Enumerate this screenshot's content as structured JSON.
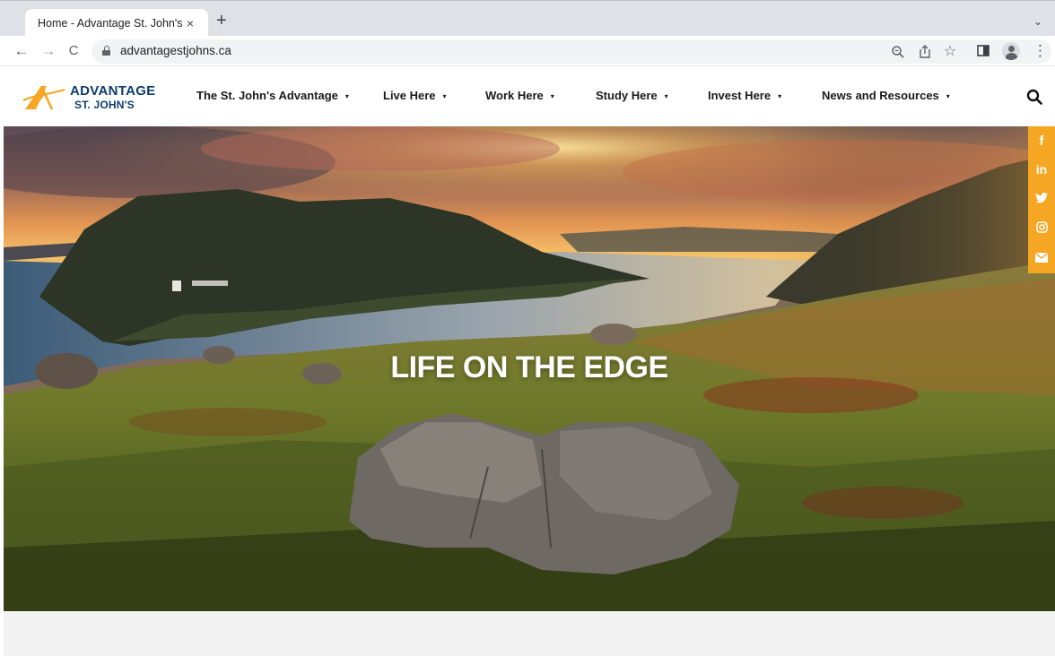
{
  "browser": {
    "tab_title": "Home - Advantage St. John's",
    "tab_close": "×",
    "new_tab": "+",
    "tab_menu": "⌄",
    "url": "advantagestjohns.ca",
    "back": "←",
    "forward": "→",
    "reload": "C",
    "menu": "⋮"
  },
  "site": {
    "logo_line1": "ADVANTAGE",
    "logo_line2": "ST. JOHN'S",
    "nav": [
      {
        "label": "The St. John's Advantage"
      },
      {
        "label": "Live Here"
      },
      {
        "label": "Work Here"
      },
      {
        "label": "Study Here"
      },
      {
        "label": "Invest Here"
      },
      {
        "label": "News and Resources"
      }
    ],
    "caret": "▾"
  },
  "hero": {
    "title": "LIFE ON THE EDGE"
  },
  "social": {
    "facebook": "f",
    "linkedin": "in",
    "twitter": "twitter-icon",
    "instagram": "instagram-icon",
    "email": "email-icon"
  },
  "colors": {
    "brand_navy": "#0d3d6c",
    "brand_orange": "#f5a623"
  }
}
